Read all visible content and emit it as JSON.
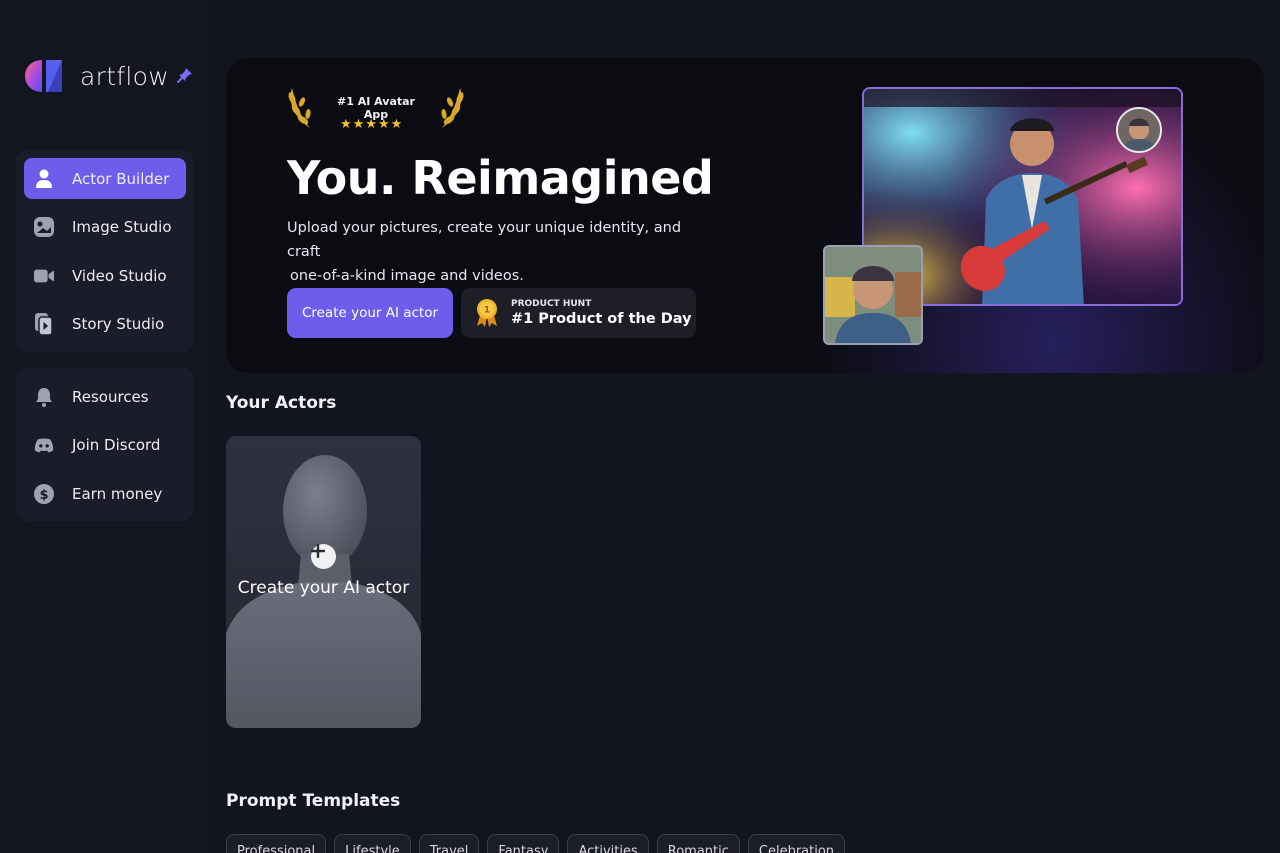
{
  "brand": {
    "name": "artflow",
    "pin_icon": "pin-icon",
    "accent": "#6d5dea"
  },
  "sidebar": {
    "primary": [
      {
        "label": "Actor Builder",
        "icon": "user-icon",
        "active": true
      },
      {
        "label": "Image Studio",
        "icon": "image-studio-icon",
        "active": false
      },
      {
        "label": "Video Studio",
        "icon": "video-camera-icon",
        "active": false
      },
      {
        "label": "Story Studio",
        "icon": "story-icon",
        "active": false
      }
    ],
    "secondary": [
      {
        "label": "Resources",
        "icon": "bell-icon"
      },
      {
        "label": "Join Discord",
        "icon": "discord-icon"
      },
      {
        "label": "Earn money",
        "icon": "dollar-icon"
      }
    ]
  },
  "hero": {
    "award_text": "#1 AI Avatar App",
    "stars": "★★★★★",
    "title": "You. Reimagined",
    "subtitle_line1": "Upload your pictures, create your unique identity, and craft",
    "subtitle_line2": "one-of-a-kind image and videos.",
    "cta_label": "Create your AI actor",
    "badge_small": "PRODUCT HUNT",
    "badge_big": "#1 Product of the Day",
    "medal_number": "1"
  },
  "actors": {
    "section_title": "Your Actors",
    "create_label": "Create your AI actor"
  },
  "templates": {
    "section_title": "Prompt Templates",
    "tags": [
      "Professional",
      "Lifestyle",
      "Travel",
      "Fantasy",
      "Activities",
      "Romantic",
      "Celebration"
    ]
  }
}
